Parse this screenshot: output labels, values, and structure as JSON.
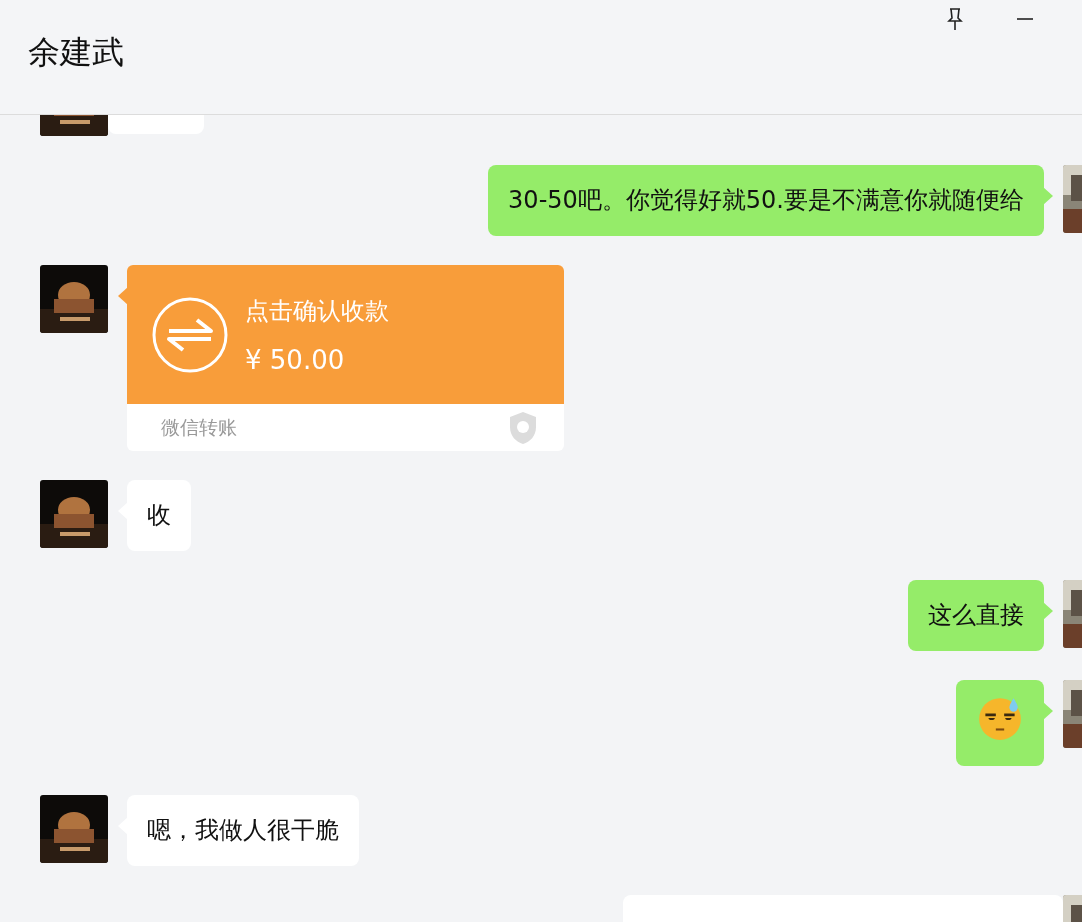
{
  "window": {
    "title": "余建武",
    "controls": [
      {
        "kind": "pin"
      },
      {
        "kind": "minimize"
      }
    ]
  },
  "messages": [
    {
      "outgoing": false,
      "kind": "partial"
    },
    {
      "outgoing": true,
      "kind": "text",
      "text": "30-50吧。你觉得好就50.要是不满意你就随便给"
    },
    {
      "outgoing": false,
      "kind": "transfer",
      "title": "点击确认收款",
      "amount": "¥ 50.00",
      "footer": "微信转账"
    },
    {
      "outgoing": false,
      "kind": "text",
      "text": "收"
    },
    {
      "outgoing": true,
      "kind": "text",
      "text": "这么直接"
    },
    {
      "outgoing": true,
      "kind": "emoji"
    },
    {
      "outgoing": false,
      "kind": "text",
      "text": "嗯，我做人很干脆"
    },
    {
      "outgoing": true,
      "kind": "partial"
    }
  ]
}
